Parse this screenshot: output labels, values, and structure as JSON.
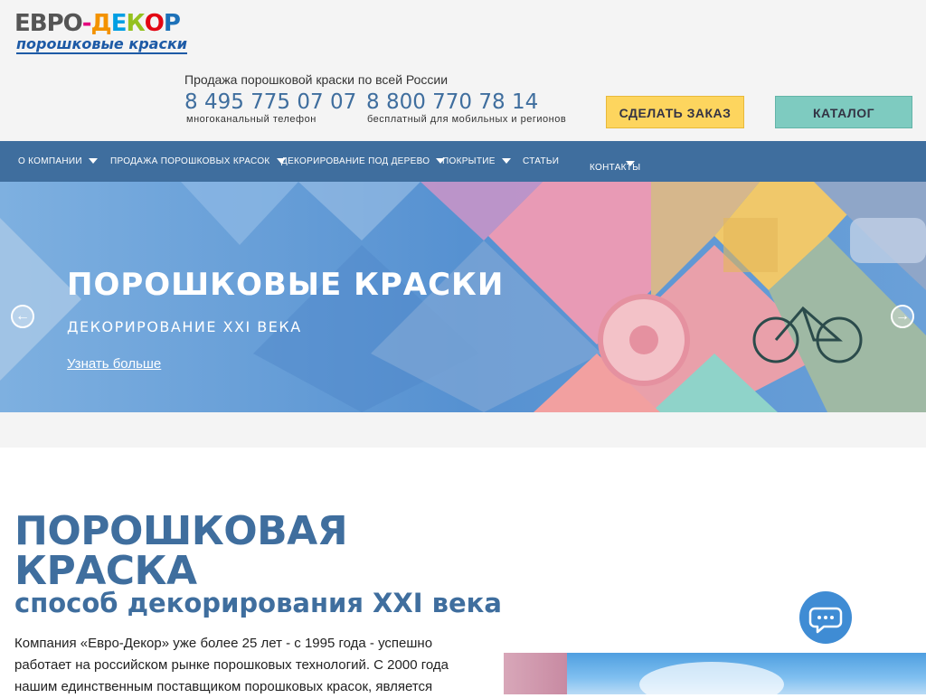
{
  "header": {
    "logo_top": [
      "ЕВРО",
      "-",
      "Д",
      "Е",
      "К",
      "О",
      "Р"
    ],
    "logo_bottom": "порошковые краски",
    "sales_line": "Продажа порошковой краски по всей России",
    "phone1": "8 495 775 07 07",
    "phone1_note": "многоканальный телефон",
    "phone2": "8 800 770 78 14",
    "phone2_note": "бесплатный для мобильных и регионов",
    "order_button": "СДЕЛАТЬ ЗАКАЗ",
    "catalog_button": "КАТАЛОГ"
  },
  "nav": {
    "items": [
      {
        "label": "О КОМПАНИИ",
        "has_dropdown": true
      },
      {
        "label": "ПРОДАЖА ПОРОШКОВЫХ КРАСОК",
        "has_dropdown": true
      },
      {
        "label": "ДЕКОРИРОВАНИЕ ПОД ДЕРЕВО",
        "has_dropdown": true
      },
      {
        "label": "ПОКРЫТИЕ",
        "has_dropdown": true
      },
      {
        "label": "СТАТЬИ",
        "has_dropdown": false
      },
      {
        "label": "КОНТАКТЫ",
        "has_dropdown": true
      }
    ]
  },
  "slider": {
    "title": "ПОРОШКОВЫЕ КРАСКИ",
    "subtitle": "ДЕКОРИРОВАНИЕ XXI ВЕКА",
    "link": "Узнать больше",
    "prev_icon": "arrow-left-icon",
    "next_icon": "arrow-right-icon"
  },
  "main": {
    "heading_line1": "ПОРОШКОВАЯ",
    "heading_line2": "КРАСКА",
    "subheading": "способ декорирования XXI века",
    "paragraph_lines": [
      "Компания «Евро-Декор» уже более 25 лет - с 1995 года - успешно",
      "работает на российском рынке порошковых технологий. С 2000 года",
      "нашим единственным поставщиком порошковых красок, является"
    ]
  },
  "chat": {
    "icon": "chat-icon"
  },
  "colors": {
    "brand_blue": "#3f6e9e",
    "order_yellow": "#fdd55e",
    "catalog_teal": "#7ecbc0",
    "header_bg": "#f4f4f4"
  }
}
